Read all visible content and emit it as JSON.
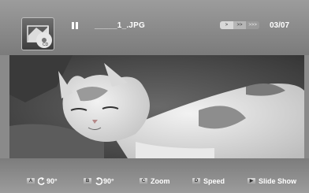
{
  "header": {
    "play_state_icon": "pause-icon",
    "filename": "_____1_.JPG",
    "speed_indicator": ">  >>  >>>",
    "counter": "03/07"
  },
  "controls": [
    {
      "key": "A",
      "icon": "rotate-left-icon",
      "label": "90°"
    },
    {
      "key": "B",
      "icon": "rotate-right-icon",
      "label": "90°"
    },
    {
      "key": "C",
      "icon": "",
      "label": "Zoom"
    },
    {
      "key": "D",
      "icon": "",
      "label": "Speed"
    },
    {
      "key": "▶",
      "icon": "play-icon",
      "label": "Slide Show"
    }
  ],
  "colors": {
    "bar": "#8a8a8a",
    "text": "#ffffff"
  }
}
